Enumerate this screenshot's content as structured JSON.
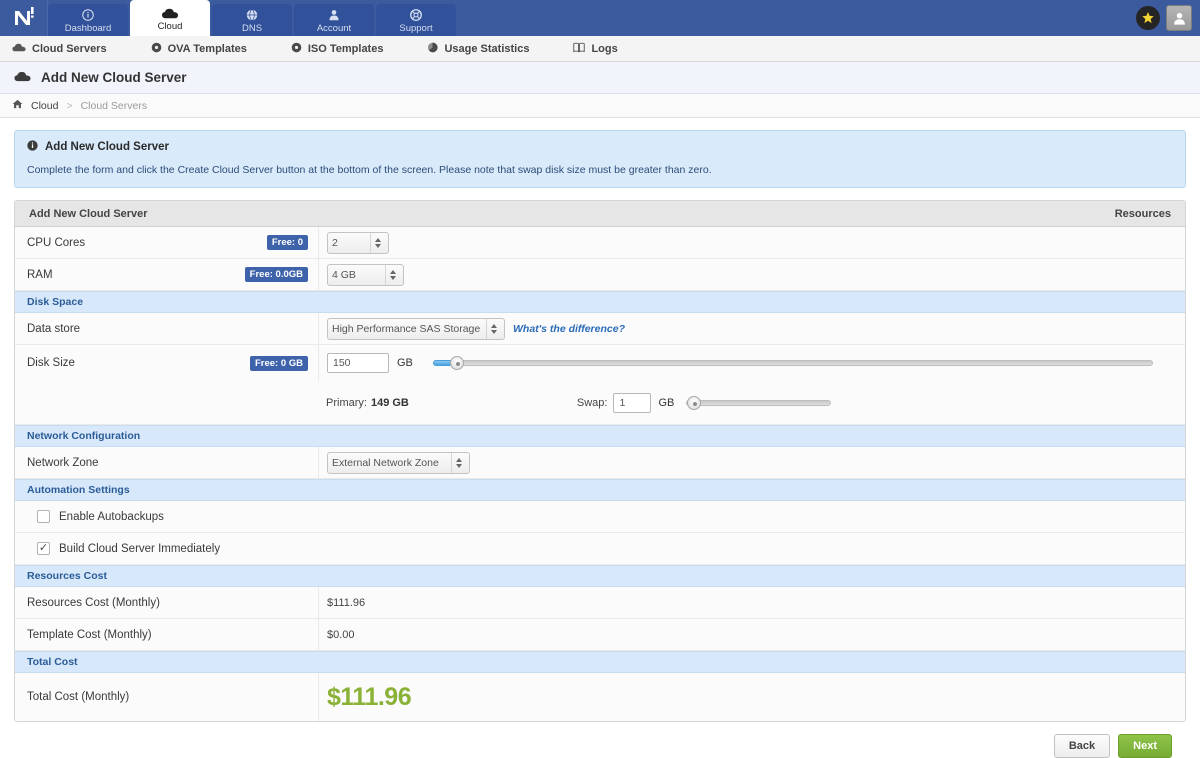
{
  "topnav": {
    "logo_alt": "provider-logo",
    "tabs": [
      {
        "label": "Dashboard",
        "icon": "info-circle-icon",
        "active": false
      },
      {
        "label": "Cloud",
        "icon": "cloud-icon",
        "active": true
      },
      {
        "label": "DNS",
        "icon": "globe-icon",
        "active": false
      },
      {
        "label": "Account",
        "icon": "person-icon",
        "active": false
      },
      {
        "label": "Support",
        "icon": "lifebuoy-icon",
        "active": false
      }
    ],
    "star_button": "favorites-star",
    "user_button": "user-avatar"
  },
  "subnav": {
    "items": [
      {
        "label": "Cloud Servers",
        "icon": "cloud-icon"
      },
      {
        "label": "OVA Templates",
        "icon": "disc-icon"
      },
      {
        "label": "ISO Templates",
        "icon": "disc-icon"
      },
      {
        "label": "Usage Statistics",
        "icon": "pie-chart-icon"
      },
      {
        "label": "Logs",
        "icon": "book-icon"
      }
    ]
  },
  "page_header": {
    "title": "Add New Cloud Server",
    "icon": "cloud-icon"
  },
  "breadcrumb": {
    "home_icon": "home-icon",
    "items": [
      "Cloud",
      "Cloud Servers"
    ],
    "separator": ">"
  },
  "info_box": {
    "icon": "info-circle-icon",
    "title": "Add New Cloud Server",
    "text": "Complete the form and click the Create Cloud Server button at the bottom of the screen. Please note that swap disk size must be greater than zero."
  },
  "panel": {
    "title": "Add New Cloud Server",
    "right_label": "Resources"
  },
  "form": {
    "cpu": {
      "label": "CPU Cores",
      "badge": "Free: 0",
      "value": "2"
    },
    "ram": {
      "label": "RAM",
      "badge": "Free: 0.0GB",
      "value": "4 GB"
    },
    "disk_space_header": "Disk Space",
    "data_store": {
      "label": "Data store",
      "value": "High Performance SAS Storage",
      "link": "What's the difference?"
    },
    "disk_size": {
      "label": "Disk Size",
      "badge": "Free: 0 GB",
      "value": "150",
      "unit": "GB",
      "slider_percent": 3
    },
    "primary": {
      "label": "Primary:",
      "value": "149 GB"
    },
    "swap": {
      "label": "Swap:",
      "value": "1",
      "unit": "GB",
      "slider_percent": 1
    },
    "network_header": "Network Configuration",
    "network_zone": {
      "label": "Network Zone",
      "value": "External Network Zone"
    },
    "automation_header": "Automation Settings",
    "autobackups": {
      "label": "Enable Autobackups",
      "checked": false
    },
    "build_immediately": {
      "label": "Build Cloud Server Immediately",
      "checked": true,
      "tick": "✓"
    },
    "resources_cost_header": "Resources Cost",
    "resources_cost": {
      "label": "Resources Cost (Monthly)",
      "value": "$111.96"
    },
    "template_cost": {
      "label": "Template Cost (Monthly)",
      "value": "$0.00"
    },
    "total_cost_header": "Total Cost",
    "total_cost": {
      "label": "Total Cost (Monthly)",
      "value": "$111.96"
    }
  },
  "footer": {
    "back_label": "Back",
    "next_label": "Next"
  },
  "colors": {
    "navbar_blue": "#3c5a9e",
    "badge_blue": "#3e63ab",
    "section_blue": "#d7e8fa",
    "section_text": "#2b5c97",
    "total_green": "#8ab236",
    "button_green": "#76ac34",
    "link_blue": "#2b6cb8"
  }
}
